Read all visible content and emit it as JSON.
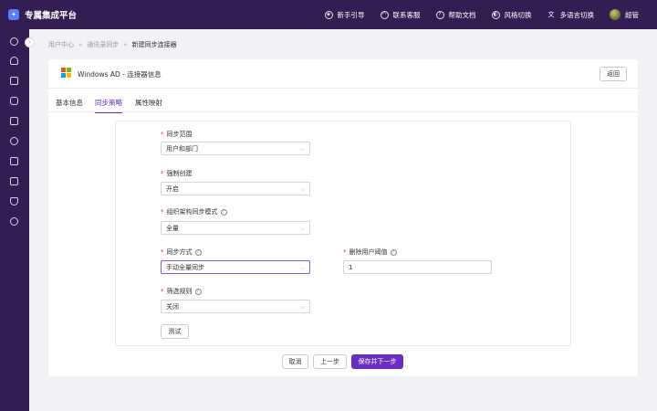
{
  "app": {
    "title": "专属集成平台",
    "logo_icon": "integration-logo-icon"
  },
  "topbar": {
    "items": [
      {
        "label": "新手引导",
        "icon": "compass-icon"
      },
      {
        "label": "联系客服",
        "icon": "headset-icon"
      },
      {
        "label": "帮助文档",
        "icon": "help-icon"
      },
      {
        "label": "风格切换",
        "icon": "palette-icon"
      },
      {
        "label": "多语言切换",
        "icon": "translate-icon"
      }
    ],
    "user": {
      "name": "超管"
    }
  },
  "sidebar": {
    "icons": [
      "rocket-icon",
      "user-icon",
      "apps-icon",
      "link-icon",
      "book-icon",
      "settings-icon",
      "stamp-icon",
      "monitor-icon",
      "trophy-icon",
      "plus-circle-icon"
    ]
  },
  "breadcrumb": [
    "用户中心",
    "通讯录同步",
    "新建同步连接器"
  ],
  "card": {
    "title": "Windows AD - 连接器信息",
    "back_label": "返回"
  },
  "tabs": [
    "基本信息",
    "同步策略",
    "属性映射"
  ],
  "active_tab": "同步策略",
  "form": {
    "sync_scope": {
      "label": "同步范围",
      "value": "用户和部门"
    },
    "force_create": {
      "label": "强制创建",
      "value": "开启"
    },
    "org_mode": {
      "label": "组织架构同步模式",
      "value": "全量"
    },
    "sync_method": {
      "label": "同步方式",
      "value": "手动全量同步"
    },
    "delete_threshold": {
      "label": "删除用户阈值",
      "value": "1"
    },
    "filter_rule": {
      "label": "筛选规则",
      "value": "关闭"
    },
    "test_label": "测试"
  },
  "footer": {
    "cancel": "取消",
    "prev": "上一步",
    "save_next": "保存并下一步"
  },
  "colors": {
    "topbar": "#341d53",
    "accent": "#6a2fc0",
    "required": "#e0362f"
  }
}
